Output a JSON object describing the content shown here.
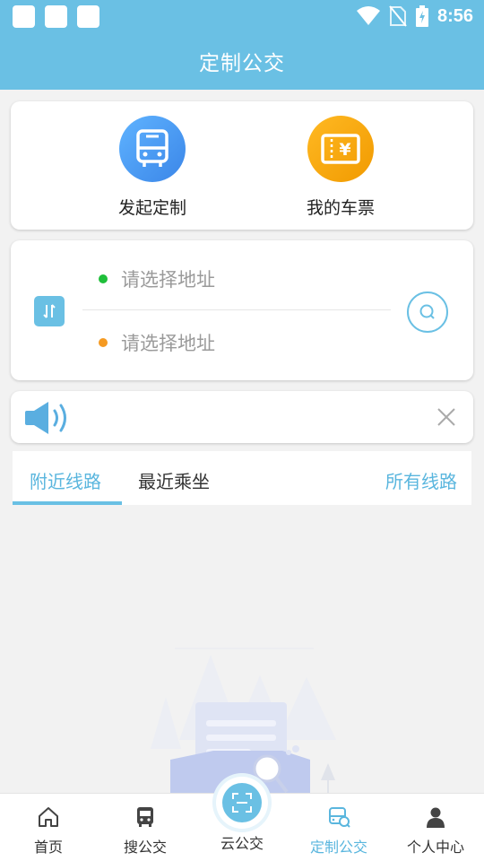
{
  "status_bar": {
    "time": "8:56"
  },
  "app_bar": {
    "title": "定制公交"
  },
  "actions": [
    {
      "label": "发起定制",
      "icon": "bus-icon",
      "color": "#4d9ff5"
    },
    {
      "label": "我的车票",
      "icon": "ticket-icon",
      "color": "#f5a30a"
    }
  ],
  "route": {
    "from_placeholder": "请选择地址",
    "to_placeholder": "请选择地址",
    "from_dot_color": "#1fbf3a",
    "to_dot_color": "#f59a22"
  },
  "tabs": [
    {
      "label": "附近线路",
      "active": true
    },
    {
      "label": "最近乘坐",
      "active": false
    }
  ],
  "all_lines": "所有线路",
  "bottom_nav": [
    {
      "label": "首页",
      "icon": "home-icon",
      "active": false
    },
    {
      "label": "搜公交",
      "icon": "bus-icon",
      "active": false
    },
    {
      "label": "云公交",
      "icon": "scan-icon",
      "active": false
    },
    {
      "label": "定制公交",
      "icon": "custom-bus-icon",
      "active": true
    },
    {
      "label": "个人中心",
      "icon": "person-icon",
      "active": false
    }
  ],
  "colors": {
    "accent": "#6ac0e4",
    "text_dark": "#222222",
    "text_muted": "#9a9a9a"
  }
}
